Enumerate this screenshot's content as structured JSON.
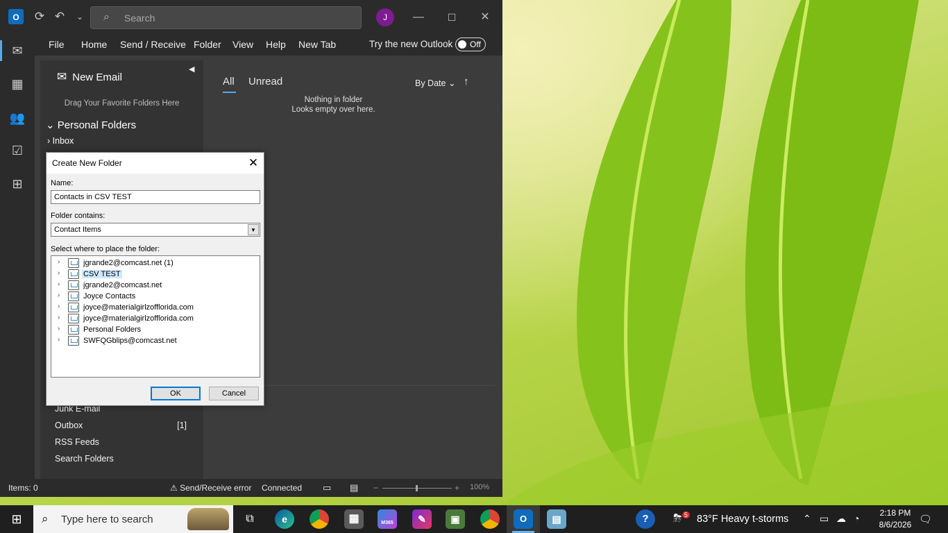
{
  "titlebar": {
    "search_placeholder": "Search",
    "avatar_initial": "J"
  },
  "menu": {
    "items": [
      "File",
      "Home",
      "Send / Receive",
      "Folder",
      "View",
      "Help",
      "New Tab"
    ],
    "try_new_outlook": "Try the new Outlook",
    "toggle_state": "Off"
  },
  "folder_pane": {
    "new_email": "New Email",
    "drag_hint": "Drag Your Favorite Folders Here",
    "personal_folders": "Personal Folders",
    "inbox": "Inbox",
    "lower_items": [
      {
        "label": "Junk E-mail",
        "count": ""
      },
      {
        "label": "Outbox",
        "count": "[1]"
      },
      {
        "label": "RSS Feeds",
        "count": ""
      },
      {
        "label": "Search Folders",
        "count": ""
      }
    ]
  },
  "message_list": {
    "tab_all": "All",
    "tab_unread": "Unread",
    "sort_by": "By Date",
    "empty_line1": "Nothing in folder",
    "empty_line2": "Looks empty over here."
  },
  "status_bar": {
    "items_count": "Items: 0",
    "send_receive_error": "Send/Receive error",
    "connection": "Connected",
    "zoom": "100%"
  },
  "dialog": {
    "title": "Create New Folder",
    "name_label": "Name:",
    "name_value": "Contacts in CSV TEST",
    "contains_label": "Folder contains:",
    "contains_value": "Contact Items",
    "place_label": "Select where to place the folder:",
    "tree": [
      {
        "label": "jgrande2@comcast.net (1)",
        "selected": false
      },
      {
        "label": "CSV TEST",
        "selected": true
      },
      {
        "label": "jgrande2@comcast.net",
        "selected": false
      },
      {
        "label": "Joyce Contacts",
        "selected": false
      },
      {
        "label": "joyce@materialgirlzofflorida.com",
        "selected": false
      },
      {
        "label": "joyce@materialgirlzofflorida.com",
        "selected": false
      },
      {
        "label": "Personal Folders",
        "selected": false
      },
      {
        "label": "SWFQGblips@comcast.net",
        "selected": false
      }
    ],
    "ok": "OK",
    "cancel": "Cancel"
  },
  "taskbar": {
    "search_placeholder": "Type here to search",
    "m365_label": "M365",
    "weather_badge": "5",
    "weather": "83°F  Heavy t-storms",
    "time": "2:18 PM",
    "date": "8/6/2026"
  },
  "colors": {
    "accent": "#5aa8e6",
    "avatar": "#7d1c8f",
    "outlook_bg": "#3c3c3c",
    "tree_selected": "#cce8ff"
  }
}
